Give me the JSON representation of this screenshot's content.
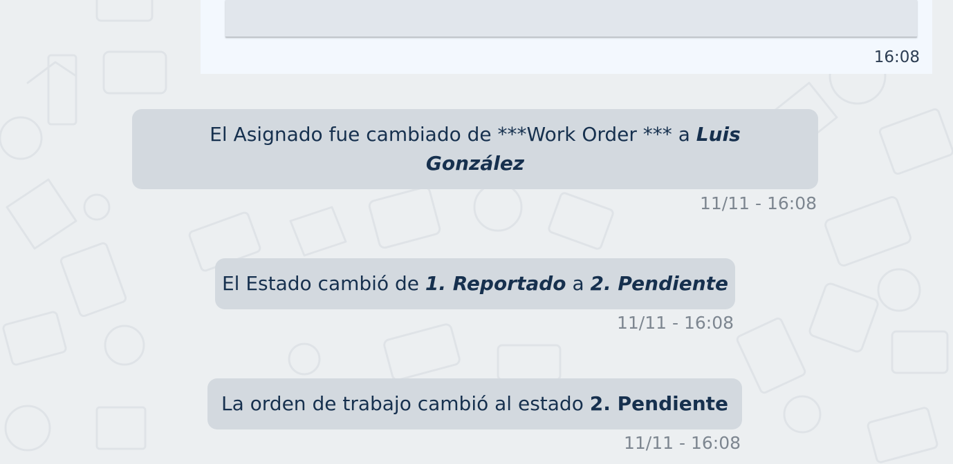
{
  "outgoing_message": {
    "time": "16:08"
  },
  "events": [
    {
      "prefix": "El Asignado fue cambiado de ***Work Order *** a ",
      "to_value": "Luis González",
      "timestamp": "11/11 - 16:08"
    },
    {
      "prefix": "El Estado cambió de ",
      "from_value": "1. Reportado",
      "connector": " a ",
      "to_value": "2. Pendiente",
      "timestamp": "11/11 - 16:08"
    },
    {
      "prefix": "La orden de trabajo cambió al estado ",
      "to_value": "2. Pendiente",
      "timestamp": "11/11 - 16:08"
    }
  ],
  "colors": {
    "background": "#eceff1",
    "event_bubble": "#d3d9df",
    "outgoing_card": "#f3f8fe",
    "text_primary": "#16304e",
    "timestamp": "#7d8690"
  }
}
